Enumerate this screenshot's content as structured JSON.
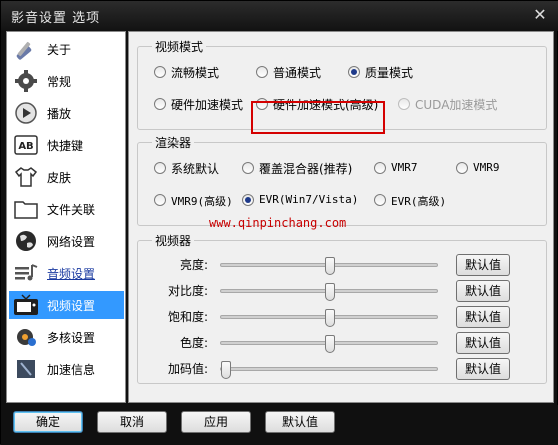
{
  "window": {
    "title": "影音设置 选项",
    "close_glyph": "✕"
  },
  "sidebar": {
    "items": [
      {
        "label": "关于",
        "icon": "tools-icon"
      },
      {
        "label": "常规",
        "icon": "gear-icon"
      },
      {
        "label": "播放",
        "icon": "play-icon"
      },
      {
        "label": "快捷键",
        "icon": "keyboard-ab-icon"
      },
      {
        "label": "皮肤",
        "icon": "shirt-icon"
      },
      {
        "label": "文件关联",
        "icon": "folder-icon"
      },
      {
        "label": "网络设置",
        "icon": "globe-icon"
      },
      {
        "label": "音频设置",
        "icon": "audio-icon"
      },
      {
        "label": "视频设置",
        "icon": "tv-icon"
      },
      {
        "label": "多核设置",
        "icon": "cpu-gear-icon"
      },
      {
        "label": "加速信息",
        "icon": "chip-icon"
      }
    ],
    "hover_index": 7,
    "selected_index": 8
  },
  "video_mode": {
    "title": "视频模式",
    "options": [
      {
        "label": "流畅模式",
        "checked": false,
        "disabled": false
      },
      {
        "label": "普通模式",
        "checked": false,
        "disabled": false
      },
      {
        "label": "质量模式",
        "checked": true,
        "disabled": false
      },
      {
        "label": "硬件加速模式",
        "checked": false,
        "disabled": false
      },
      {
        "label": "硬件加速模式(高级)",
        "checked": false,
        "disabled": false
      },
      {
        "label": "CUDA加速模式",
        "checked": false,
        "disabled": true
      }
    ]
  },
  "renderer": {
    "title": "渲染器",
    "options": [
      {
        "label": "系统默认",
        "checked": false
      },
      {
        "label": "覆盖混合器(推荐)",
        "checked": false
      },
      {
        "label": "VMR7",
        "checked": false
      },
      {
        "label": "VMR9",
        "checked": false
      },
      {
        "label": "VMR9(高级)",
        "checked": false
      },
      {
        "label": "EVR(Win7/Vista)",
        "checked": true
      },
      {
        "label": "EVR(高级)",
        "checked": false
      }
    ]
  },
  "watermark": "www.qinpinchang.com",
  "video": {
    "title": "视频器",
    "sliders": [
      {
        "label": "亮度:",
        "value": 0.5,
        "reset_label": "默认值"
      },
      {
        "label": "对比度:",
        "value": 0.5,
        "reset_label": "默认值"
      },
      {
        "label": "饱和度:",
        "value": 0.5,
        "reset_label": "默认值"
      },
      {
        "label": "色度:",
        "value": 0.5,
        "reset_label": "默认值"
      },
      {
        "label": "加码值:",
        "value": 0.0,
        "reset_label": "默认值"
      }
    ]
  },
  "footer": {
    "ok_label": "确定",
    "cancel_label": "取消",
    "apply_label": "应用",
    "default_label": "默认值"
  },
  "colors": {
    "accent": "#3399ff",
    "highlight_box": "#d40000",
    "watermark": "#c80000"
  }
}
